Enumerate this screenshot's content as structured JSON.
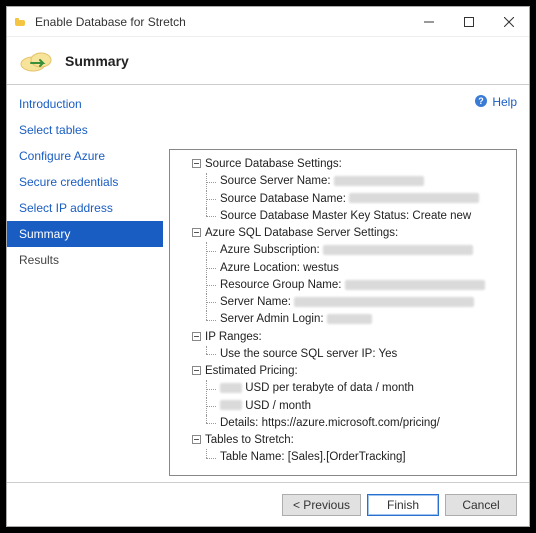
{
  "window": {
    "title": "Enable Database for Stretch"
  },
  "header": {
    "title": "Summary"
  },
  "help": {
    "label": "Help"
  },
  "nav": [
    {
      "label": "Introduction"
    },
    {
      "label": "Select tables"
    },
    {
      "label": "Configure Azure"
    },
    {
      "label": "Secure credentials"
    },
    {
      "label": "Select IP address"
    },
    {
      "label": "Summary"
    },
    {
      "label": "Results"
    }
  ],
  "tree": {
    "source": {
      "heading": "Source Database Settings:",
      "server_label": "Source Server Name:",
      "server_value_redacted": true,
      "db_label": "Source Database Name:",
      "db_value_redacted": true,
      "masterkey_label": "Source Database Master Key Status:",
      "masterkey_value": "Create new"
    },
    "azure": {
      "heading": "Azure SQL Database Server Settings:",
      "sub_label": "Azure Subscription:",
      "sub_value_redacted": true,
      "loc_label": "Azure Location:",
      "loc_value": "westus",
      "rg_label": "Resource Group Name:",
      "rg_value_redacted": true,
      "srv_label": "Server Name:",
      "srv_value_redacted": true,
      "admin_label": "Server Admin Login:",
      "admin_value_redacted": true
    },
    "ip": {
      "heading": "IP Ranges:",
      "use_src_label": "Use the source SQL server IP:",
      "use_src_value": "Yes"
    },
    "pricing": {
      "heading": "Estimated Pricing:",
      "perTB_value_redacted": true,
      "perTB_suffix": "USD per terabyte of data / month",
      "perMonth_value_redacted": true,
      "perMonth_suffix": "USD / month",
      "details_label": "Details:",
      "details_value": "https://azure.microsoft.com/pricing/"
    },
    "tables": {
      "heading": "Tables to Stretch:",
      "name_label": "Table Name:",
      "name_value": "[Sales].[OrderTracking]"
    }
  },
  "footer": {
    "previous": "< Previous",
    "finish": "Finish",
    "cancel": "Cancel"
  }
}
